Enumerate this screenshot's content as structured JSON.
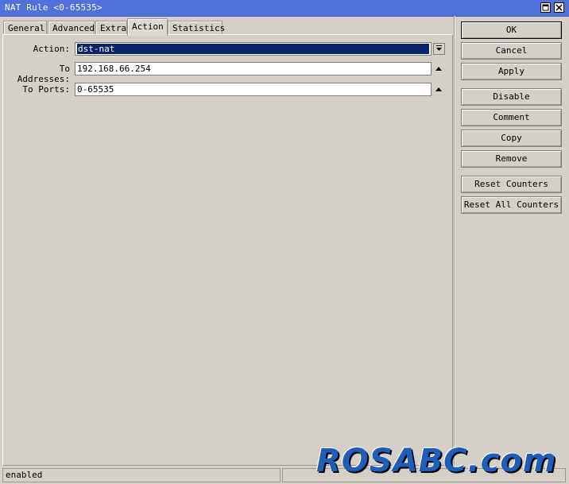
{
  "window": {
    "title": "NAT Rule <0-65535>"
  },
  "tabs": [
    {
      "label": "General"
    },
    {
      "label": "Advanced"
    },
    {
      "label": "Extra"
    },
    {
      "label": "Action"
    },
    {
      "label": "Statistics"
    }
  ],
  "active_tab": "Action",
  "form": {
    "action_label": "Action:",
    "action_value": "dst-nat",
    "to_addresses_label": "To Addresses:",
    "to_addresses_value": "192.168.66.254",
    "to_ports_label": "To Ports:",
    "to_ports_value": "0-65535"
  },
  "buttons": {
    "ok": "OK",
    "cancel": "Cancel",
    "apply": "Apply",
    "disable": "Disable",
    "comment": "Comment",
    "copy": "Copy",
    "remove": "Remove",
    "reset_counters": "Reset Counters",
    "reset_all_counters": "Reset All Counters"
  },
  "status": {
    "text": "enabled"
  },
  "watermark": "ROSABC.com",
  "colors": {
    "titlebar": "#4e72d8",
    "selection": "#0a246a",
    "face": "#d4d0c8",
    "watermark": "#1f5db8"
  }
}
